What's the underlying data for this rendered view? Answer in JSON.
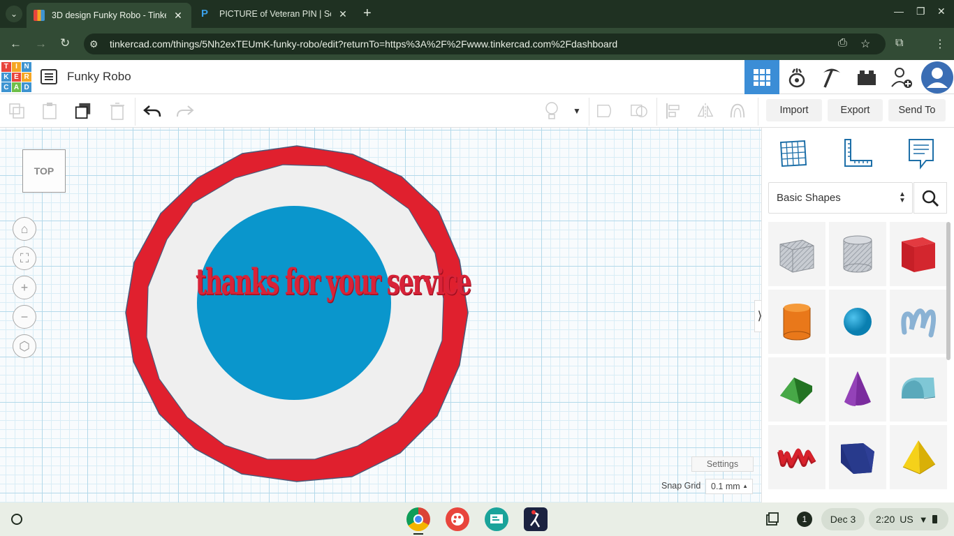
{
  "browser": {
    "tabs": [
      {
        "title": "3D design Funky Robo - Tinkercad",
        "active": true
      },
      {
        "title": "PICTURE of Veteran PIN | Schoology",
        "active": false
      }
    ],
    "url": "tinkercad.com/things/5Nh2exTEUmK-funky-robo/edit?returnTo=https%3A%2F%2Fwww.tinkercad.com%2Fdashboard"
  },
  "app": {
    "logo_letters": [
      "T",
      "I",
      "N",
      "K",
      "E",
      "R",
      "C",
      "A",
      "D"
    ],
    "design_title": "Funky Robo"
  },
  "toolbar": {
    "import_label": "Import",
    "export_label": "Export",
    "send_to_label": "Send To"
  },
  "workplane": {
    "view_cube_label": "TOP",
    "pin_text": "thanks for your service",
    "settings_label": "Settings",
    "snap_grid_label": "Snap Grid",
    "snap_grid_value": "0.1 mm",
    "colors": {
      "ring": "#e0202e",
      "inner": "#f0f0f0",
      "disc": "#0a96cc",
      "text": "#d82338"
    }
  },
  "panel": {
    "library_selected": "Basic Shapes",
    "shapes": [
      "box-hole",
      "cylinder-hole",
      "box",
      "cylinder",
      "sphere",
      "scribble",
      "roof",
      "cone",
      "round-roof",
      "text",
      "wedge",
      "pyramid"
    ]
  },
  "shelf": {
    "notification_count": "1",
    "date": "Dec 3",
    "time": "2:20",
    "locale": "US"
  }
}
